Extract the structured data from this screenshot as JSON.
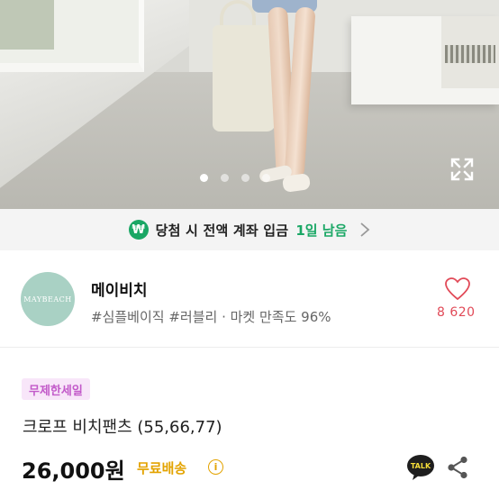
{
  "hero": {
    "slide_count": 4,
    "active_slide": 1,
    "expand_icon": "expand-icon"
  },
  "promo": {
    "icon_symbol": "₩",
    "text": "당첨 시 전액 계좌 입금",
    "highlight": "1일 남음",
    "accent_color": "#1aa765"
  },
  "shop": {
    "avatar_text": "MAYBEACH",
    "name": "메이비치",
    "tags": "#심플베이직 #러블리 · 마켓 만족도 96%",
    "like_count": "8 620",
    "like_color": "#e14a58"
  },
  "product": {
    "badge": "무제한세일",
    "title": "크로프 비치팬츠 (55,66,77)",
    "price": "26,000원",
    "shipping": "무료배송",
    "info_symbol": "i",
    "talk_label": "TALK",
    "shipping_color": "#e3a300"
  }
}
